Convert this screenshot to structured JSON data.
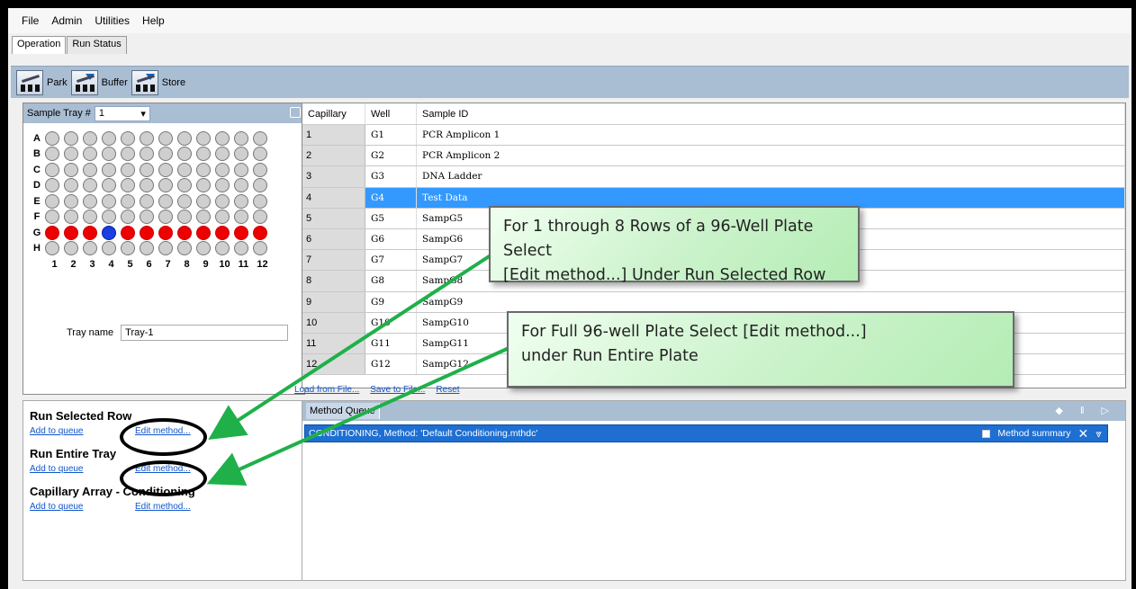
{
  "menu": [
    "File",
    "Admin",
    "Utilities",
    "Help"
  ],
  "tabs": [
    "Operation",
    "Run Status"
  ],
  "toolbar": [
    {
      "label": "Park",
      "icon": "park-icon"
    },
    {
      "label": "Buffer",
      "icon": "buffer-icon"
    },
    {
      "label": "Store",
      "icon": "store-icon"
    }
  ],
  "tray": {
    "label": "Sample Tray #",
    "number": "1",
    "rows": [
      "A",
      "B",
      "C",
      "D",
      "E",
      "F",
      "G",
      "H"
    ],
    "columns": [
      "1",
      "2",
      "3",
      "4",
      "5",
      "6",
      "7",
      "8",
      "9",
      "10",
      "11",
      "12"
    ],
    "selected_row": "G",
    "highlight_well": "G4",
    "name_label": "Tray name",
    "name_value": "Tray-1"
  },
  "table": {
    "headers": [
      "Capillary",
      "Well",
      "Sample ID"
    ],
    "rows": [
      [
        "1",
        "G1",
        "PCR Amplicon 1"
      ],
      [
        "2",
        "G2",
        "PCR Amplicon 2"
      ],
      [
        "3",
        "G3",
        "DNA Ladder"
      ],
      [
        "4",
        "G4",
        "Test Data"
      ],
      [
        "5",
        "G5",
        "SampG5"
      ],
      [
        "6",
        "G6",
        "SampG6"
      ],
      [
        "7",
        "G7",
        "SampG7"
      ],
      [
        "8",
        "G8",
        "SampG8"
      ],
      [
        "9",
        "G9",
        "SampG9"
      ],
      [
        "10",
        "G10",
        "SampG10"
      ],
      [
        "11",
        "G11",
        "SampG11"
      ],
      [
        "12",
        "G12",
        "SampG12"
      ]
    ],
    "selected_index": 3,
    "links": [
      "Load from File...",
      "Save to File...",
      "Reset"
    ]
  },
  "run": {
    "sections": [
      {
        "title": "Run Selected Row",
        "add": "Add to queue",
        "edit": "Edit method..."
      },
      {
        "title": "Run Entire Tray",
        "add": "Add to queue",
        "edit": "Edit method..."
      },
      {
        "title": "Capillary Array - Conditioning",
        "add": "Add to queue",
        "edit": "Edit method..."
      }
    ]
  },
  "queue": {
    "title": "Method Queue",
    "item": "CONDITIONING, Method: 'Default Conditioning.mthdc'",
    "summary": "Method summary"
  },
  "callouts": {
    "a_line1": "For 1 through 8 Rows of a 96-Well Plate Select",
    "a_line2": "[Edit method...] Under Run Selected Row",
    "b_line1": "For Full 96-well Plate Select [Edit method...]",
    "b_line2": "under Run Entire Plate"
  },
  "colors": {
    "header_blue": "#a9bdd3",
    "selected_row": "#3399ff",
    "well_selected": "#ee0000",
    "well_highlight": "#1a3ee0",
    "arrow": "#1fb04a"
  }
}
